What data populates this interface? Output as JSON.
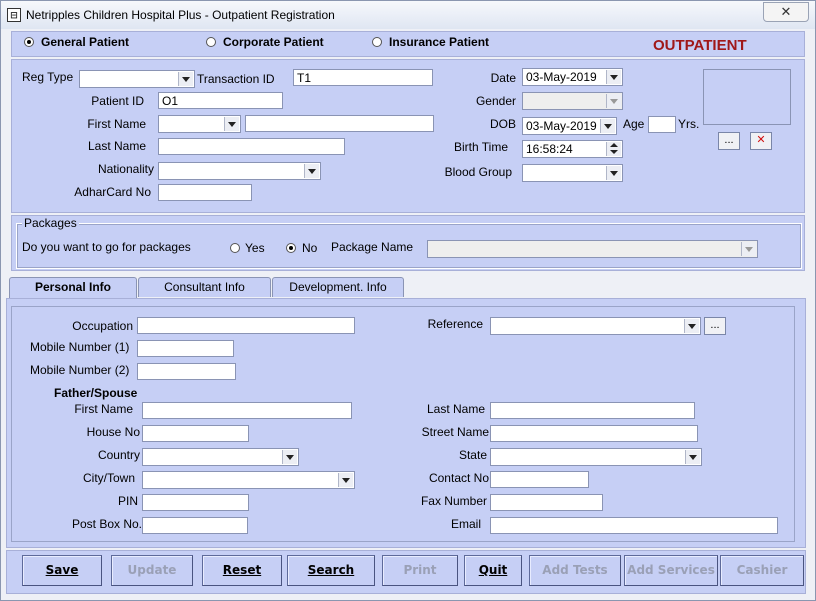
{
  "window": {
    "title": "Netripples Children Hospital Plus - Outpatient Registration",
    "close": "✕",
    "icon": "app-icon"
  },
  "patient_type": {
    "general": "General Patient",
    "corporate": "Corporate Patient",
    "insurance": "Insurance Patient",
    "selected": "general"
  },
  "heading": "OUTPATIENT",
  "heading_color": "#a01818",
  "reg": {
    "reg_type_label": "Reg Type",
    "reg_type_value": "",
    "transaction_id_label": "Transaction ID",
    "transaction_id_value": "T1",
    "patient_id_label": "Patient ID",
    "patient_id_value": "O1",
    "first_name_label": "First Name",
    "title_value": "",
    "first_name_value": "",
    "last_name_label": "Last Name",
    "last_name_value": "",
    "nationality_label": "Nationality",
    "nationality_value": "",
    "adhar_label": "AdharCard No",
    "adhar_value": "",
    "date_label": "Date",
    "date_value": "03-May-2019",
    "gender_label": "Gender",
    "gender_value": "",
    "dob_label": "DOB",
    "dob_value": "03-May-2019",
    "age_label": "Age",
    "age_value": "",
    "yrs_label": "Yrs.",
    "birth_time_label": "Birth Time",
    "birth_time_value": "16:58:24",
    "blood_group_label": "Blood Group",
    "blood_group_value": "",
    "photo_browse": "...",
    "photo_clear": "✕"
  },
  "packages": {
    "title": "Packages",
    "question": "Do you want to go for packages",
    "yes": "Yes",
    "no": "No",
    "selected": "no",
    "package_name_label": "Package Name",
    "package_name_value": ""
  },
  "tabs": [
    {
      "label": "Personal Info",
      "active": true
    },
    {
      "label": "Consultant Info",
      "active": false
    },
    {
      "label": "Development. Info",
      "active": false
    }
  ],
  "personal": {
    "occupation_label": "Occupation",
    "occupation_value": "",
    "reference_label": "Reference",
    "reference_value": "",
    "reference_browse": "...",
    "mobile1_label": "Mobile Number (1)",
    "mobile1_value": "",
    "mobile2_label": "Mobile Number (2)",
    "mobile2_value": "",
    "father_spouse_label": "Father/Spouse",
    "first_name_label": "First Name",
    "first_name_value": "",
    "last_name_label": "Last Name",
    "last_name_value": "",
    "house_no_label": "House No",
    "house_no_value": "",
    "street_name_label": "Street Name",
    "street_name_value": "",
    "country_label": "Country",
    "country_value": "",
    "state_label": "State",
    "state_value": "",
    "city_label": "City/Town",
    "city_value": "",
    "contact_no_label": "Contact No",
    "contact_no_value": "",
    "pin_label": "PIN",
    "pin_value": "",
    "fax_label": "Fax Number",
    "fax_value": "",
    "post_box_label": "Post Box No.",
    "post_box_value": "",
    "email_label": "Email",
    "email_value": ""
  },
  "buttons": [
    {
      "label": "Save",
      "enabled": true
    },
    {
      "label": "Update",
      "enabled": false
    },
    {
      "label": "Reset",
      "enabled": true
    },
    {
      "label": "Search",
      "enabled": true
    },
    {
      "label": "Print",
      "enabled": false
    },
    {
      "label": "Quit",
      "enabled": true
    },
    {
      "label": "Add Tests",
      "enabled": false
    },
    {
      "label": "Add Services",
      "enabled": false
    },
    {
      "label": "Cashier",
      "enabled": false
    }
  ]
}
